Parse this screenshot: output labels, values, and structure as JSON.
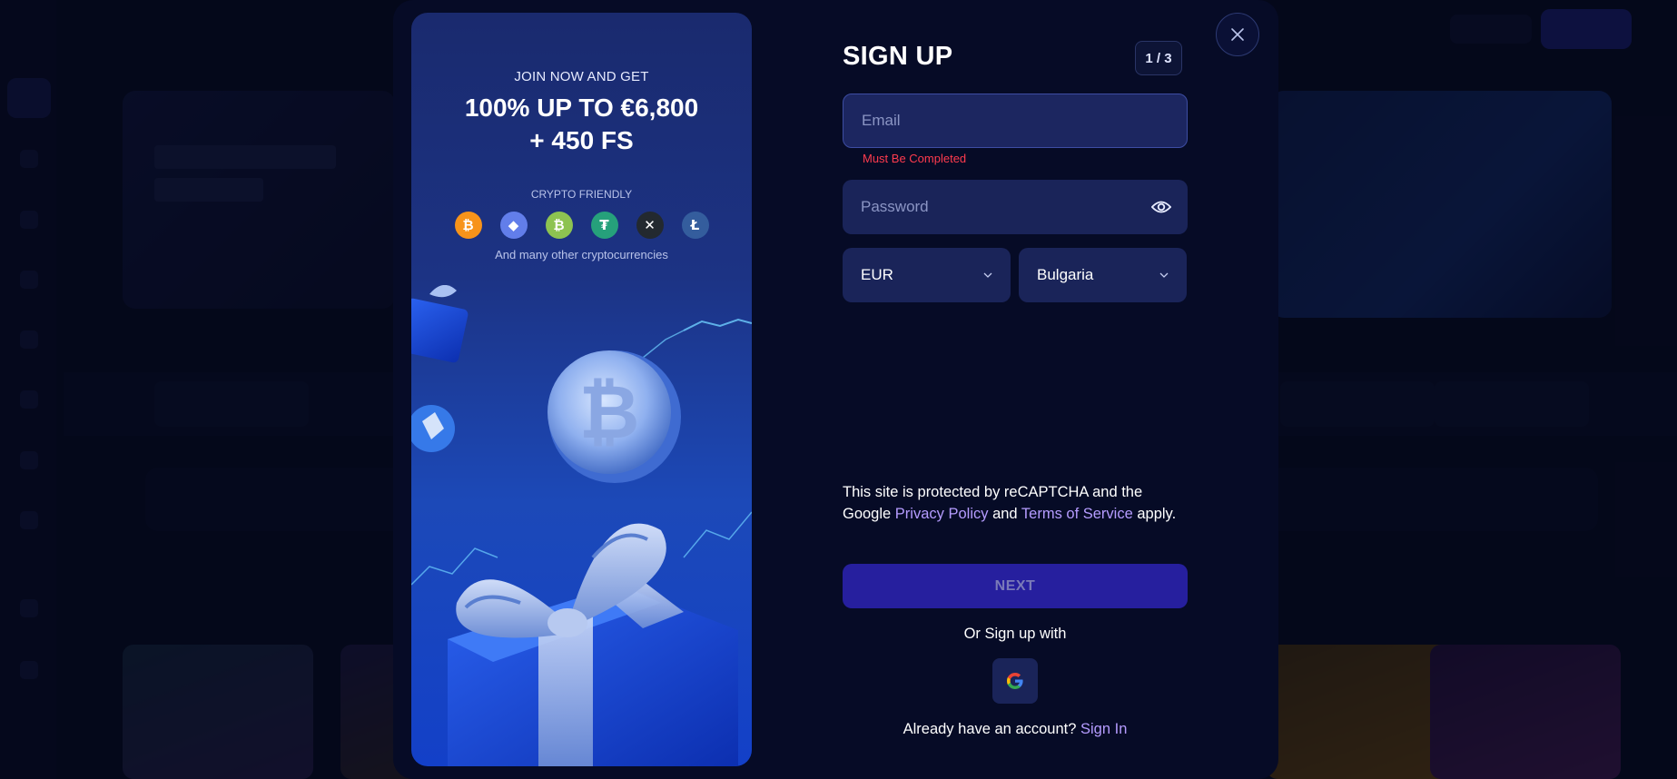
{
  "promo": {
    "join_text": "JOIN NOW AND GET",
    "bonus_line1": "100% UP TO €6,800",
    "bonus_line2": "+ 450 FS",
    "crypto_label": "CRYPTO FRIENDLY",
    "coins": [
      {
        "name": "bitcoin",
        "glyph": "₿",
        "color": "#f7931a"
      },
      {
        "name": "ethereum",
        "glyph": "◆",
        "color": "#627eea"
      },
      {
        "name": "bitcoin-cash",
        "glyph": "₿",
        "color": "#8dc351"
      },
      {
        "name": "tether",
        "glyph": "₮",
        "color": "#26a17b"
      },
      {
        "name": "ripple",
        "glyph": "✕",
        "color": "#23292f"
      },
      {
        "name": "litecoin",
        "glyph": "Ł",
        "color": "#345d9d"
      }
    ],
    "other_text": "And many other cryptocurrencies"
  },
  "form": {
    "title": "SIGN UP",
    "step": "1 / 3",
    "email_placeholder": "Email",
    "email_error": "Must Be Completed",
    "password_placeholder": "Password",
    "currency": "EUR",
    "country": "Bulgaria",
    "recaptcha_prefix": "This site is protected by reCAPTCHA and the Google ",
    "privacy_link": "Privacy Policy",
    "recaptcha_and": " and ",
    "terms_link": "Terms of Service",
    "recaptcha_suffix": " apply.",
    "next_label": "NEXT",
    "or_signup": "Or Sign up with",
    "have_account": "Already have an account? ",
    "signin_link": "Sign In"
  },
  "colors": {
    "accent": "#261f9e",
    "link": "#b59cff",
    "error": "#ff3b4e",
    "field_bg": "#1a2459"
  }
}
